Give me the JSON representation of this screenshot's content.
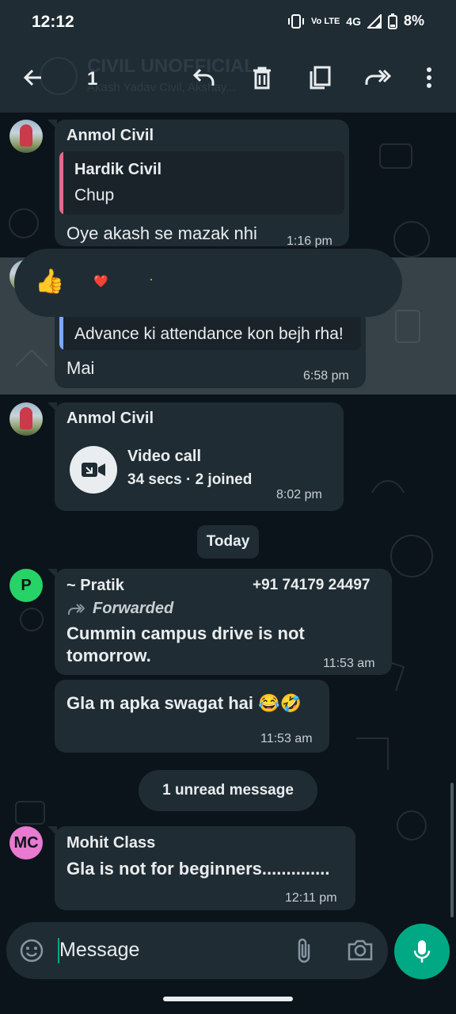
{
  "status": {
    "time": "12:12",
    "volte": "Vo LTE",
    "network": "4G",
    "battery": "8%"
  },
  "header": {
    "selected_count": "1",
    "group_name": "CIVIL UNOFFICIAL",
    "group_members": "Akash Yadav Civil, Akshay..."
  },
  "messages": [
    {
      "sender": "Anmol Civil",
      "sender_color": "#e9edef",
      "quote": {
        "author": "Hardik Civil",
        "text": "Chup",
        "bar_color": "#e36a8d"
      },
      "text": "Oye akash se mazak nhi",
      "time": "1:16 pm"
    },
    {
      "quote": {
        "text": "Advance ki attendance kon bejh rha!",
        "bar_color": "#7da8ff"
      },
      "text": "Mai",
      "time": "6:58 pm"
    },
    {
      "sender": "Anmol Civil",
      "call": {
        "title": "Video call",
        "detail": "34 secs · 2 joined"
      },
      "time": "8:02 pm"
    },
    {
      "sender": "~ Pratik",
      "phone": "+91 74179 24497",
      "forwarded": "Forwarded",
      "text": "Cummin campus drive is not tomorrow.",
      "time": "11:53 am",
      "avatar_letter": "P",
      "avatar_color": "#25d366"
    },
    {
      "text": "Gla m apka swagat hai 😂🤣",
      "time": "11:53 am"
    },
    {
      "sender": "Mohit Class",
      "text": "Gla is not for beginners..............",
      "time": "12:11 pm",
      "avatar_letter": "MC",
      "avatar_color": "#e87ad1"
    }
  ],
  "date_divider": "Today",
  "unread_banner": "1 unread message",
  "reactions": [
    "👍",
    "❤️",
    "·"
  ],
  "composer": {
    "placeholder": "Message"
  },
  "colors": {
    "accent": "#00a884",
    "bubble": "#202c33",
    "background": "#0b141a"
  }
}
